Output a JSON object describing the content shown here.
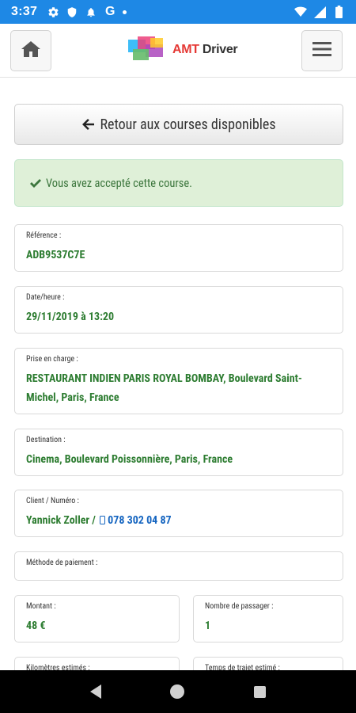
{
  "status_bar": {
    "time": "3:37",
    "left_icons": [
      "gear-icon",
      "shield-icon",
      "bell-icon",
      "google-g-icon",
      "dot-icon"
    ],
    "right_icons": [
      "wifi-icon",
      "signal-icon",
      "battery-icon"
    ],
    "google_letter": "G"
  },
  "header": {
    "logo": {
      "amt": "AMT",
      "driver": " Driver"
    },
    "home_icon": "home-icon",
    "menu_icon": "hamburger-menu-icon"
  },
  "back_button": {
    "label": "Retour aux courses disponibles",
    "icon": "arrow-left-icon"
  },
  "alert": {
    "message": "Vous avez accepté cette course.",
    "icon": "check-icon",
    "color": "#3c763d",
    "background": "#dff0d8"
  },
  "fields": {
    "reference": {
      "label": "Référence :",
      "value": "ADB9537C7E"
    },
    "datetime": {
      "label": "Date/heure :",
      "value": "29/11/2019 à 13:20"
    },
    "pickup": {
      "label": "Prise en charge :",
      "value": "RESTAURANT INDIEN PARIS ROYAL BOMBAY, Boulevard Saint-Michel, Paris, France"
    },
    "destination": {
      "label": "Destination :",
      "value": "Cinema, Boulevard Poissonnière, Paris, France"
    },
    "client": {
      "label": "Client / Numéro :",
      "name": "Yannick Zoller / ",
      "phone": "078 302 04 87",
      "phone_icon": "mobile-phone-icon"
    },
    "payment": {
      "label": "Méthode de paiement :",
      "value": ""
    },
    "amount": {
      "label": "Montant :",
      "value": "48 €"
    },
    "passengers": {
      "label": "Nombre de passager :",
      "value": "1"
    },
    "km": {
      "label": "Kilomètres estimés :"
    },
    "duration": {
      "label": "Temps de trajet estimé :"
    }
  },
  "colors": {
    "accent": "#1e88e5",
    "value_green": "#2e7d32",
    "link_blue": "#1565c0"
  }
}
